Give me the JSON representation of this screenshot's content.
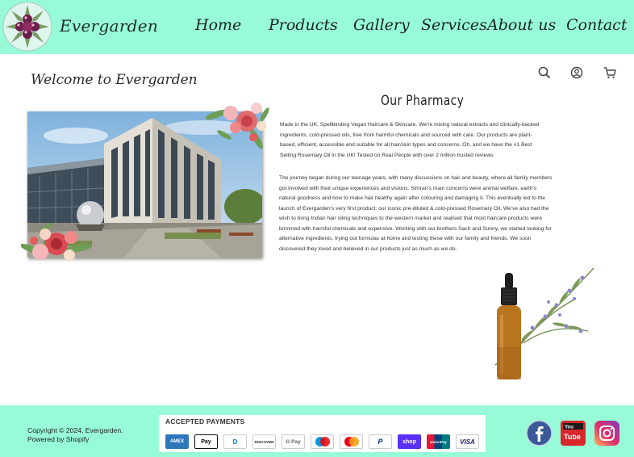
{
  "header": {
    "brand": "Evergarden",
    "nav": [
      "Home",
      "Products",
      "Gallery",
      "Services",
      "About us",
      "Contact"
    ]
  },
  "main": {
    "welcome": "Welcome to Evergarden",
    "section_title": "Our Pharmacy",
    "paragraph1": "Made in the UK, Spellbinding Vegan Haircare & Skincare. We're mixing natural extracts and clinically-backed ingredients, cold-pressed oils, free from harmful chemicals and sourced with care. Our products are plant-based, efficient, accessible and suitable for all hair/skin types and concerns. Oh, and we have the #1 Best Selling Rosemary Oil in the UK! Tested on Real People with over 2 million trusted reviews",
    "paragraph2": "The journey began during our teenage years, with many discussions on hair and beauty, where all family members got involved with their unique experiences and visions. Simran's main concerns were animal welfare, earth's natural goodness and how to make hair healthy again after colouring and damaging it. This eventually led to the launch of Evergarden's very first product: our iconic pre-diluted & cold-pressed Rosemary Oil. We've also had the wish to bring Indian hair oiling techniques to the western market and realised that most haircare products were brimmed with harmful chemicals and expensive. Working with our brothers Sach and Sunny, we started looking for alternative ingredients, trying out formulas at home and testing these with our family and friends. We soon discovered they loved and believed in our products just as much as we do."
  },
  "utility_icons": [
    "search-icon",
    "account-icon",
    "cart-icon"
  ],
  "footer": {
    "copyright": "Copyright © 2024, Evergarden.",
    "powered_by": "Powered by Shopify",
    "payments_title": "ACCEPTED PAYMENTS",
    "payment_methods": [
      {
        "name": "AMEX",
        "color": "#2e77bb"
      },
      {
        "name": "Pay",
        "color": "#000000"
      },
      {
        "name": "D",
        "color": "#0079be"
      },
      {
        "name": "DISCOVER",
        "color": "#231f20"
      },
      {
        "name": "G Pay",
        "color": "#5f6368"
      },
      {
        "name": "maestro",
        "color": "#0099df"
      },
      {
        "name": "mastercard",
        "color": "#eb001b"
      },
      {
        "name": "P",
        "color": "#003087"
      },
      {
        "name": "shop",
        "color": "#5a31f4"
      },
      {
        "name": "UnionPay",
        "color": "#e21836"
      },
      {
        "name": "VISA",
        "color": "#1a1f71"
      }
    ],
    "social": [
      "facebook-icon",
      "youtube-icon",
      "instagram-icon"
    ]
  },
  "colors": {
    "accent_mint": "#96fbd6",
    "text_dark": "#222222"
  }
}
